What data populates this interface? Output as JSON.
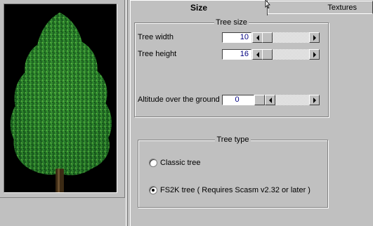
{
  "tabs": {
    "size": "Size",
    "textures": "Textures"
  },
  "tree_size": {
    "title": "Tree size",
    "width_label": "Tree width",
    "width_value": "10",
    "height_label": "Tree height",
    "height_value": "16",
    "altitude_label": "Altitude over the ground",
    "altitude_value": "0"
  },
  "tree_type": {
    "title": "Tree type",
    "options": [
      {
        "label": "Classic tree",
        "selected": false
      },
      {
        "label": "FS2K tree ( Requires Scasm v2.32 or later )",
        "selected": true
      }
    ]
  },
  "colors": {
    "face": "#c0c0c0",
    "edit_text": "#000080",
    "preview_bg": "#000000",
    "foliage": "#2e8b2e"
  }
}
